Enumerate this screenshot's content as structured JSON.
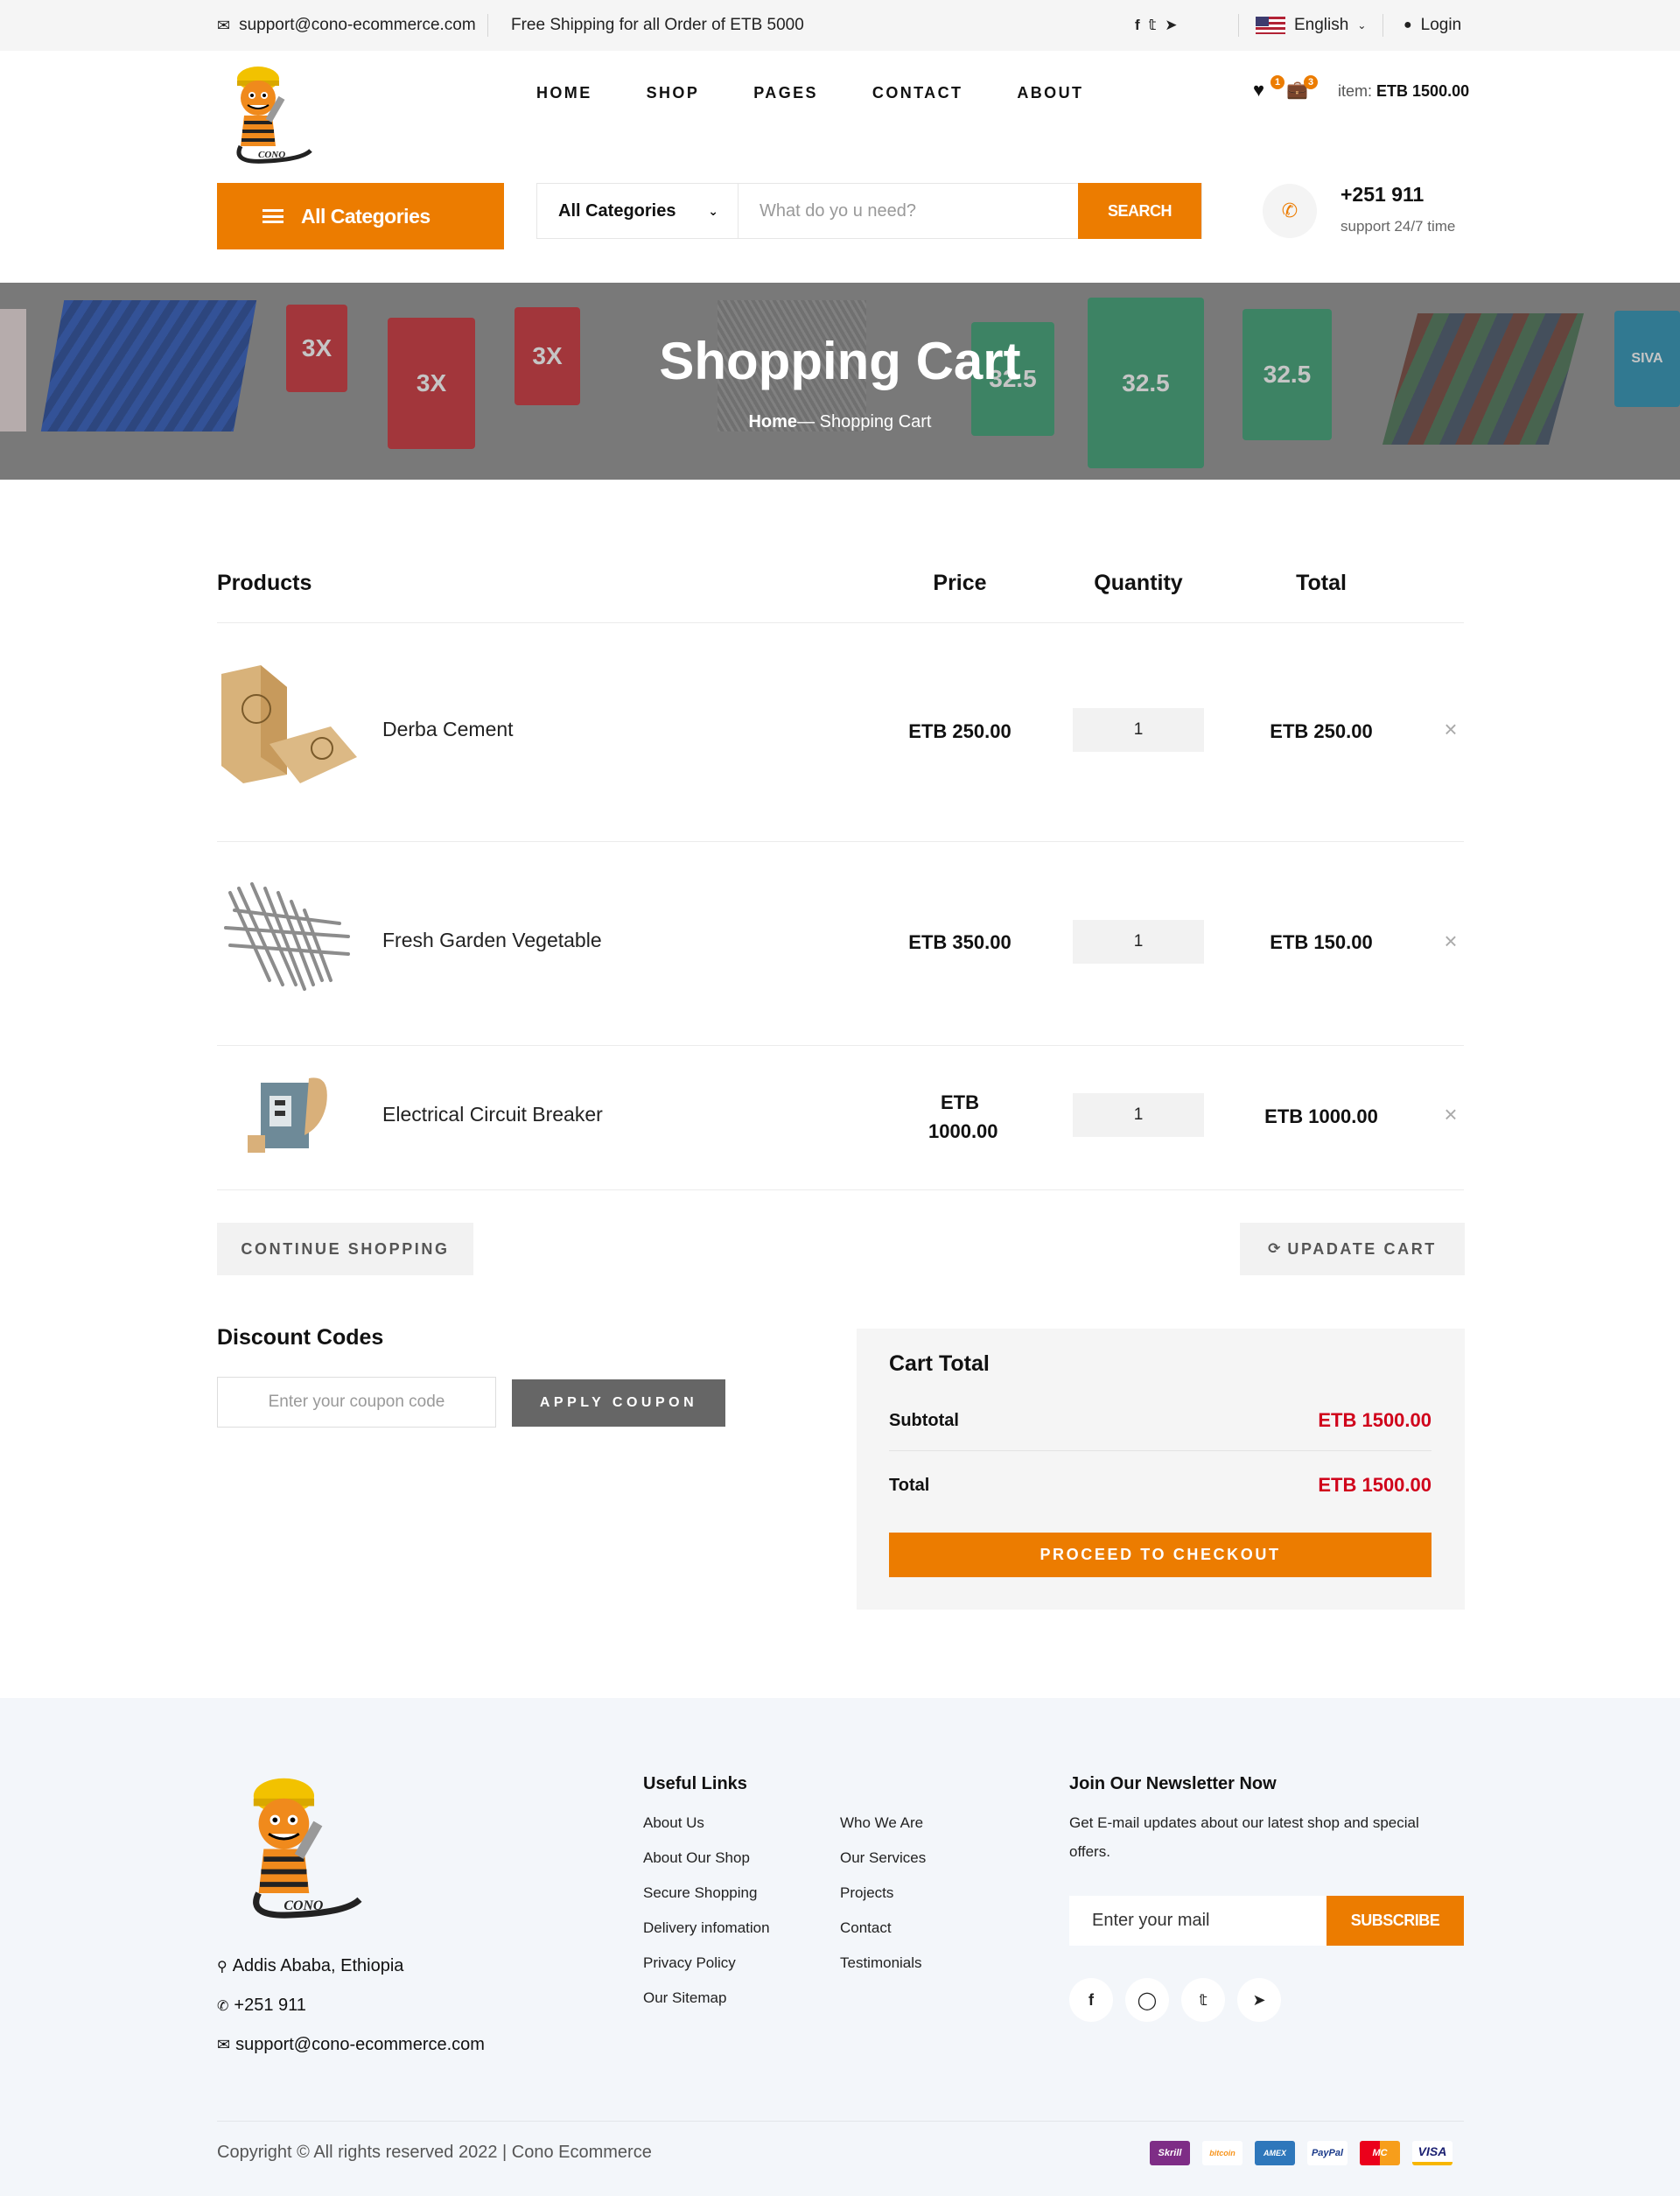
{
  "topbar": {
    "email": "support@cono-ecommerce.com",
    "shipping": "Free Shipping for all Order of ETB 5000",
    "language": "English",
    "login": "Login"
  },
  "nav": {
    "items": [
      "HOME",
      "SHOP",
      "PAGES",
      "CONTACT",
      "ABOUT"
    ]
  },
  "header": {
    "wishlist_count": "1",
    "cart_count": "3",
    "item_label": "item:",
    "item_total": "ETB 1500.00",
    "categories_button": "All Categories",
    "search_category": "All Categories",
    "search_placeholder": "What do yo u need?",
    "search_button": "SEARCH",
    "phone": "+251 911",
    "support": "support 24/7 time"
  },
  "hero": {
    "title": "Shopping Cart",
    "crumb_home": "Home",
    "crumb_sep": "—",
    "crumb_current": "Shopping Cart",
    "bag_labels": [
      "3X",
      "3X",
      "3X",
      "32.5",
      "32.5",
      "32.5",
      "SIVA"
    ]
  },
  "cart": {
    "headers": {
      "products": "Products",
      "price": "Price",
      "quantity": "Quantity",
      "total": "Total"
    },
    "items": [
      {
        "name": "Derba Cement",
        "price": "ETB 250.00",
        "qty": "1",
        "total": "ETB 250.00"
      },
      {
        "name": "Fresh Garden Vegetable",
        "price": "ETB 350.00",
        "qty": "1",
        "total": "ETB 150.00"
      },
      {
        "name": "Electrical Circuit Breaker",
        "price": "ETB 1000.00",
        "qty": "1",
        "total": "ETB 1000.00"
      }
    ],
    "continue_button": "CONTINUE SHOPPING",
    "update_button": "UPADATE CART"
  },
  "discount": {
    "title": "Discount Codes",
    "placeholder": "Enter your coupon code",
    "apply_button": "APPLY COUPON"
  },
  "totals": {
    "title": "Cart Total",
    "subtotal_label": "Subtotal",
    "subtotal_value": "ETB 1500.00",
    "total_label": "Total",
    "total_value": "ETB 1500.00",
    "checkout_button": "PROCEED TO CHECKOUT"
  },
  "footer": {
    "address": "Addis Ababa, Ethiopia",
    "phone": "+251 911",
    "email": "support@cono-ecommerce.com",
    "links_title": "Useful Links",
    "links_col1": [
      "About Us",
      "About Our Shop",
      "Secure Shopping",
      "Delivery infomation",
      "Privacy Policy",
      "Our Sitemap"
    ],
    "links_col2": [
      "Who We Are",
      "Our Services",
      "Projects",
      "Contact",
      "Testimonials"
    ],
    "newsletter_title": "Join Our Newsletter Now",
    "newsletter_text": "Get E-mail updates about our latest shop and special offers.",
    "newsletter_placeholder": "Enter your mail",
    "subscribe_button": "SUBSCRIBE",
    "copyright": "Copyright © All rights reserved 2022 | Cono Ecommerce",
    "payments": [
      "Skrill",
      "bitcoin",
      "AMEX",
      "PayPal",
      "MC",
      "VISA"
    ]
  },
  "logo_text": "CONO",
  "colors": {
    "accent": "#ec7c00",
    "price_red": "#d0021b"
  }
}
